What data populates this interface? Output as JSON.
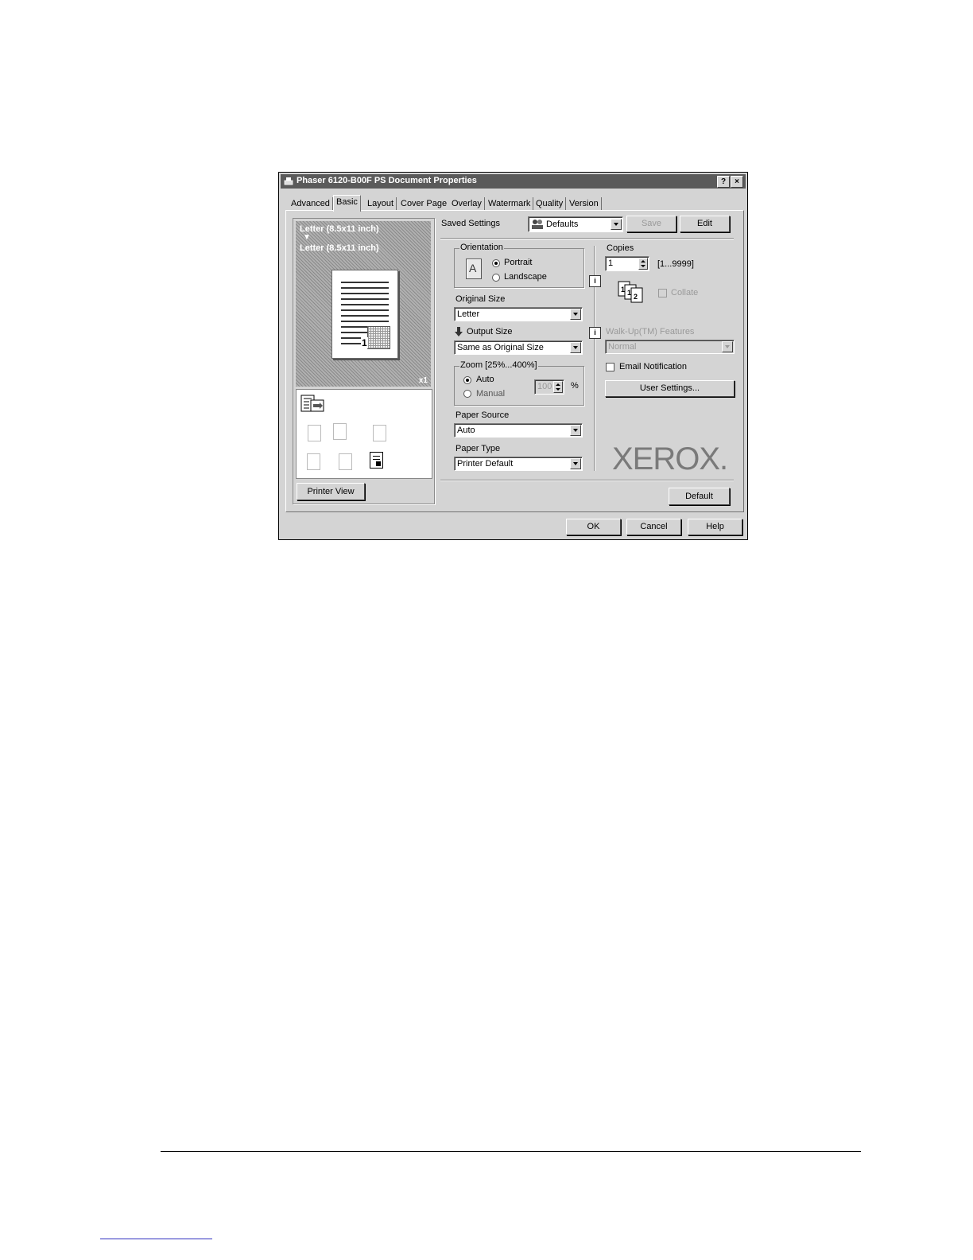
{
  "window": {
    "title": "Phaser 6120-B00F PS Document Properties",
    "help_glyph": "?",
    "close_glyph": "×"
  },
  "tabs": [
    "Advanced",
    "Basic",
    "Layout",
    "Cover Page",
    "Overlay",
    "Watermark",
    "Quality",
    "Version"
  ],
  "active_tab": "Basic",
  "preview": {
    "line1": "Letter (8.5x11 inch)",
    "arrow": "▼",
    "line2": "Letter (8.5x11 inch)",
    "page_number": "1",
    "copies_marker": "x1",
    "printer_view_label": "Printer View"
  },
  "saved_settings": {
    "label": "Saved Settings",
    "value": "Defaults",
    "save_label": "Save",
    "edit_label": "Edit"
  },
  "orientation": {
    "legend": "Orientation",
    "portrait": "Portrait",
    "landscape": "Landscape",
    "selected": "Portrait",
    "icon_letter": "A"
  },
  "original_size": {
    "label": "Original Size",
    "value": "Letter"
  },
  "output_size": {
    "label": "Output Size",
    "value": "Same as Original Size"
  },
  "zoom": {
    "legend": "Zoom [25%...400%]",
    "auto": "Auto",
    "manual": "Manual",
    "value": "100",
    "unit": "%",
    "selected": "Auto"
  },
  "paper_source": {
    "label": "Paper Source",
    "value": "Auto"
  },
  "paper_type": {
    "label": "Paper Type",
    "value": "Printer Default"
  },
  "copies": {
    "label": "Copies",
    "value": "1",
    "range": "[1...9999]",
    "collate_label": "Collate"
  },
  "walkup": {
    "label": "Walk-Up(TM) Features",
    "value": "Normal"
  },
  "email_notification": {
    "label": "Email Notification",
    "checked": false
  },
  "user_settings_label": "User Settings...",
  "brand_logo": "XEROX.",
  "info_glyph": "i",
  "default_label": "Default",
  "footer": {
    "ok": "OK",
    "cancel": "Cancel",
    "help": "Help"
  }
}
